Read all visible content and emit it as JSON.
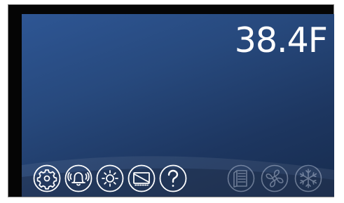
{
  "display": {
    "temperature": "38.4F"
  },
  "toolbar": {
    "left_icons": [
      "gear-icon",
      "alarm-bell-icon",
      "brightness-icon",
      "display-icon",
      "help-icon"
    ],
    "right_icons": [
      "door-icon",
      "fan-icon",
      "snowflake-icon"
    ],
    "right_icons_state": "inactive"
  },
  "colors": {
    "screen_top": "#2e5694",
    "screen_bottom": "#172c4e",
    "bezel": "#050505",
    "icon_active": "#ffffff",
    "icon_inactive": "#c8d3e6"
  }
}
